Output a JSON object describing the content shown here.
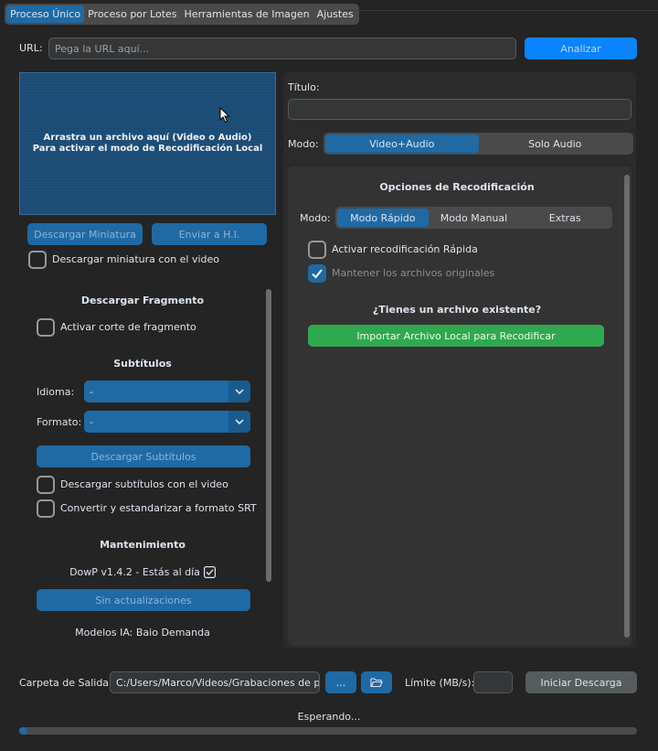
{
  "tabs": [
    {
      "label": "Proceso Único",
      "active": true
    },
    {
      "label": "Proceso por Lotes",
      "active": false
    },
    {
      "label": "Herramientas de Imagen",
      "active": false
    },
    {
      "label": "Ajustes",
      "active": false
    }
  ],
  "url_row": {
    "label": "URL:",
    "placeholder": "Pega la URL aquí...",
    "analyze_button": "Analizar"
  },
  "dropzone": {
    "line1": "Arrastra un archivo aquí (Video o Audio)",
    "line2": "Para activar el modo de Recodificación Local"
  },
  "thumb_buttons": {
    "download": "Descargar Miniatura",
    "send": "Enviar a H.I."
  },
  "thumb_checkbox": {
    "label": "Descargar miniatura con el video",
    "checked": false
  },
  "left_panel": {
    "fragment": {
      "title": "Descargar Fragmento",
      "checkbox_label": "Activar corte de fragmento",
      "checked": false
    },
    "subtitles": {
      "title": "Subtítulos",
      "language_label": "Idioma:",
      "language_value": "-",
      "format_label": "Formato:",
      "format_value": "-",
      "download_button": "Descargar Subtítulos",
      "chk_with_video": "Descargar subtítulos con el video",
      "chk_srt": "Convertir y estandarizar a formato SRT"
    },
    "maintenance": {
      "title": "Mantenimiento",
      "version_text": "DowP v1.4.2 - Estás al día",
      "version_checked": true,
      "no_updates_button": "Sin actualizaciones",
      "models_text": "Modelos IA: Bajo Demanda"
    }
  },
  "right_panel": {
    "title_label": "Título:",
    "title_value": "",
    "mode_label": "Modo:",
    "mode_options": [
      "Video+Audio",
      "Solo Audio"
    ],
    "mode_selected": 0,
    "recode": {
      "title": "Opciones de Recodificación",
      "mode_label": "Modo:",
      "mode_options": [
        "Modo Rápido",
        "Modo Manual",
        "Extras"
      ],
      "mode_selected": 0,
      "chk_fast": {
        "label": "Activar recodificación Rápida",
        "checked": false
      },
      "chk_keep": {
        "label": "Mantener los archivos originales",
        "checked": true
      },
      "existing_title": "¿Tienes un archivo existente?",
      "import_button": "Importar Archivo Local para Recodificar"
    }
  },
  "bottom": {
    "output_label": "Carpeta de Salida:",
    "output_value": "C:/Users/Marco/Videos/Grabaciones de pan",
    "browse_button": "...",
    "folder_icon": "folder-open-icon",
    "limit_label": "Límite (MB/s):",
    "limit_value": "",
    "start_button": "Iniciar Descarga",
    "status": "Esperando...",
    "progress": 0.012
  },
  "colors": {
    "accent": "#1f6aa5",
    "analyze": "#0a84ff",
    "green": "#2fa84f",
    "bg": "#242424"
  }
}
